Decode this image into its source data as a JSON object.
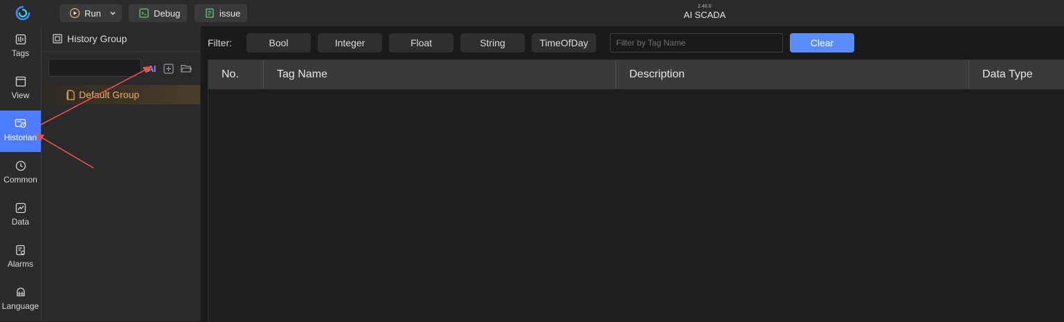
{
  "app": {
    "title": "AI SCADA",
    "version": "2.40.0"
  },
  "toolbar": {
    "run_label": "Run",
    "debug_label": "Debug",
    "issue_label": "issue"
  },
  "nav": {
    "items": [
      {
        "label": "Tags",
        "icon": "tags-icon"
      },
      {
        "label": "View",
        "icon": "view-icon"
      },
      {
        "label": "Historian",
        "icon": "historian-icon",
        "active": true
      },
      {
        "label": "Common",
        "icon": "common-icon"
      },
      {
        "label": "Data",
        "icon": "data-icon"
      },
      {
        "label": "Alarms",
        "icon": "alarms-icon"
      },
      {
        "label": "Language",
        "icon": "language-icon"
      }
    ]
  },
  "history_panel": {
    "title": "History Group",
    "search_value": "",
    "ai_label": "AI",
    "groups": [
      {
        "label": "Default Group",
        "selected": true
      }
    ]
  },
  "filter": {
    "label": "Filter:",
    "types": [
      "Bool",
      "Integer",
      "Float",
      "String",
      "TimeOfDay"
    ],
    "placeholder": "Filter by Tag Name",
    "clear_label": "Clear"
  },
  "table": {
    "columns": [
      "No.",
      "Tag Name",
      "Description",
      "Data Type"
    ],
    "rows": []
  },
  "colors": {
    "accent": "#4d7cff",
    "clear_button": "#5b8cff",
    "selected_group_text": "#e8b15e",
    "annotation_arrow": "#e8524a"
  }
}
